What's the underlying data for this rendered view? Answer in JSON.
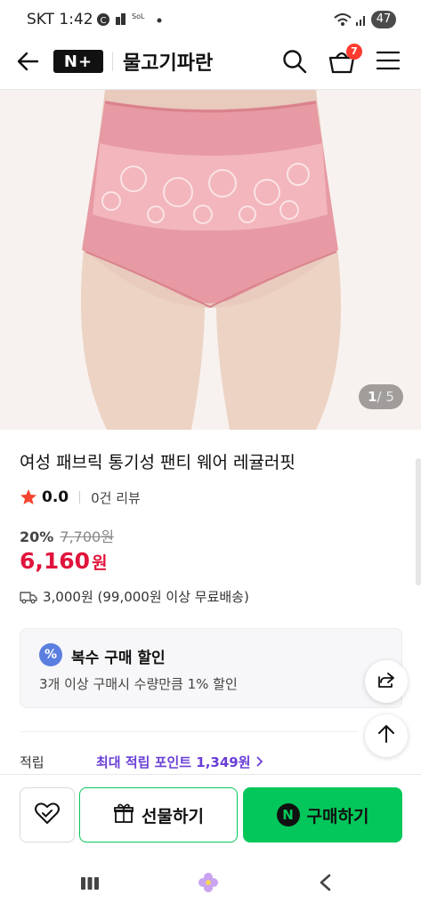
{
  "status_bar": {
    "carrier_time": "SKT 1:42",
    "battery": "47"
  },
  "header": {
    "logo": "N+",
    "store_name": "물고기파란",
    "cart_count": "7"
  },
  "gallery": {
    "counter_current": "1",
    "counter_total": "/ 5"
  },
  "product": {
    "title": "여성 패브릭 통기성 팬티 웨어 레귤러핏",
    "rating": "0.0",
    "reviews": "0건 리뷰",
    "discount": "20%",
    "original_price": "7,700원",
    "price_number": "6,160",
    "price_unit": "원",
    "shipping": "3,000원 (99,000원 이상 무료배송)"
  },
  "promo": {
    "title": "복수 구매 할인",
    "description": "3개 이상 구매시 수량만큼 1% 할인",
    "icon_text": "%"
  },
  "points": {
    "label": "적립",
    "value": "최대 적립 포인트 1,349원"
  },
  "actions": {
    "gift_label": "선물하기",
    "buy_label": "구매하기",
    "buy_badge": "N"
  },
  "colors": {
    "price_red": "#e0143c",
    "naver_green": "#03c75a",
    "points_purple": "#6a3fd6",
    "cart_badge": "#ff3b30"
  }
}
